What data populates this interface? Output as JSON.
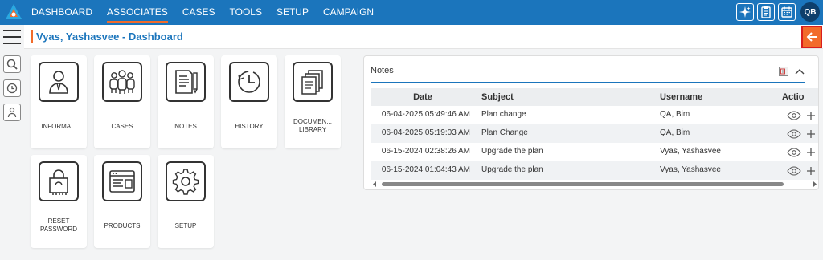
{
  "nav": {
    "items": [
      "DASHBOARD",
      "ASSOCIATES",
      "CASES",
      "TOOLS",
      "SETUP",
      "CAMPAIGN"
    ],
    "active": "ASSOCIATES",
    "user_initials": "QB"
  },
  "header": {
    "title": "Vyas, Yashasvee - Dashboard"
  },
  "tiles": [
    {
      "label": "INFORMA...",
      "icon": "person-info-icon"
    },
    {
      "label": "CASES",
      "icon": "group-icon"
    },
    {
      "label": "NOTES",
      "icon": "notes-icon"
    },
    {
      "label": "HISTORY",
      "icon": "clock-icon"
    },
    {
      "label": "DOCUMEN... LIBRARY",
      "icon": "documents-icon"
    },
    {
      "label": "RESET PASSWORD",
      "icon": "lock-icon"
    },
    {
      "label": "PRODUCTS",
      "icon": "products-icon"
    },
    {
      "label": "SETUP",
      "icon": "gear-icon"
    }
  ],
  "notes": {
    "title": "Notes",
    "columns": {
      "date": "Date",
      "subject": "Subject",
      "username": "Username",
      "actions": "Actio"
    },
    "rows": [
      {
        "date": "06-04-2025 05:49:46 AM",
        "subject": "Plan change",
        "username": "QA, Bim"
      },
      {
        "date": "06-04-2025 05:19:03 AM",
        "subject": "Plan Change",
        "username": "QA, Bim"
      },
      {
        "date": "06-15-2024 02:38:26 AM",
        "subject": "Upgrade the plan",
        "username": "Vyas, Yashasvee"
      },
      {
        "date": "06-15-2024 01:04:43 AM",
        "subject": "Upgrade the plan",
        "username": "Vyas, Yashasvee"
      }
    ]
  },
  "colors": {
    "brand": "#1b75bc",
    "accent": "#f26b2a"
  }
}
